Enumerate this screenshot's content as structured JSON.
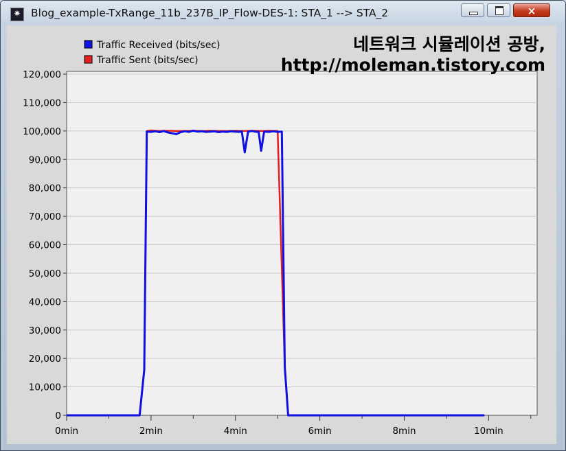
{
  "window": {
    "title": "Blog_example-TxRange_11b_237B_IP_Flow-DES-1: STA_1 --> STA_2",
    "icon": "opnet-star-icon",
    "buttons": {
      "minimize": "minimize-icon",
      "maximize": "maximize-icon",
      "close": "×"
    }
  },
  "watermark": {
    "line1": "네트워크 시뮬레이션 공방,",
    "line2": "http://moleman.tistory.com"
  },
  "colors": {
    "received": "#1010e0",
    "sent": "#e02020",
    "plot_bg": "#f0f0f0",
    "panel_bg": "#d9d9d9"
  },
  "chart_data": {
    "type": "line",
    "xlabel": "",
    "ylabel": "",
    "xlim": [
      0,
      11.15
    ],
    "ylim": [
      0,
      120000
    ],
    "xticks": [
      "0min",
      "2min",
      "4min",
      "6min",
      "8min",
      "10min"
    ],
    "yticks": [
      "0",
      "10,000",
      "20,000",
      "30,000",
      "40,000",
      "50,000",
      "60,000",
      "70,000",
      "80,000",
      "90,000",
      "100,000",
      "110,000",
      "120,000"
    ],
    "legend_position": "top-left",
    "grid": "horizontal",
    "series": [
      {
        "name": "Traffic Received (bits/sec)",
        "color": "#1010e0",
        "x": [
          0,
          1.73,
          1.84,
          1.9,
          2.0,
          2.1,
          2.2,
          2.3,
          2.4,
          2.5,
          2.6,
          2.7,
          2.8,
          2.9,
          3.0,
          3.1,
          3.2,
          3.3,
          3.4,
          3.5,
          3.6,
          3.7,
          3.8,
          3.9,
          4.0,
          4.1,
          4.15,
          4.22,
          4.3,
          4.4,
          4.5,
          4.55,
          4.61,
          4.68,
          4.8,
          4.9,
          5.0,
          5.1,
          5.17,
          5.25,
          5.35,
          9.9
        ],
        "y": [
          0,
          0,
          16000,
          99800,
          99700,
          99900,
          99600,
          100000,
          99500,
          99200,
          98900,
          99600,
          99900,
          99700,
          100100,
          99800,
          99900,
          99700,
          99800,
          99900,
          99600,
          99800,
          99700,
          99900,
          99800,
          99700,
          99900,
          92500,
          99800,
          100000,
          99700,
          99800,
          93000,
          99800,
          99700,
          99900,
          99700,
          99800,
          17000,
          0,
          0,
          0
        ]
      },
      {
        "name": "Traffic Sent (bits/sec)",
        "color": "#e02020",
        "x": [
          0,
          1.73,
          1.84,
          1.9,
          2.0,
          2.2,
          2.4,
          2.6,
          2.8,
          3.0,
          3.2,
          3.4,
          3.6,
          3.8,
          4.0,
          4.2,
          4.4,
          4.6,
          4.8,
          5.0,
          5.17,
          5.25,
          5.35,
          9.9
        ],
        "y": [
          0,
          0,
          16000,
          100000,
          100200,
          100000,
          100100,
          100000,
          100000,
          100100,
          100000,
          100100,
          100000,
          100000,
          100100,
          100000,
          100100,
          100000,
          100100,
          100000,
          17000,
          0,
          0,
          0
        ]
      }
    ]
  }
}
